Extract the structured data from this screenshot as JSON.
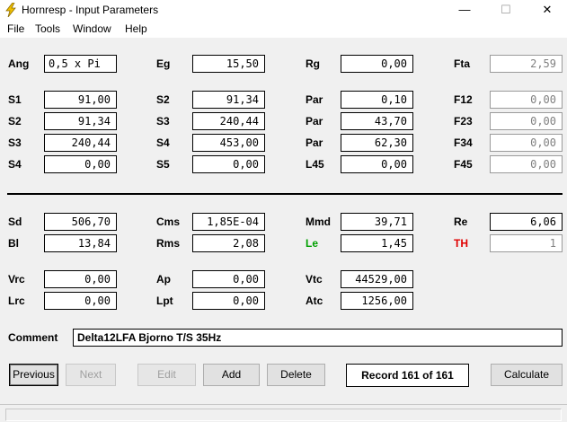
{
  "window": {
    "title": "Hornresp - Input Parameters",
    "min_glyph": "—",
    "max_glyph": "☐",
    "close_glyph": "✕"
  },
  "menu": {
    "file": "File",
    "tools": "Tools",
    "window": "Window",
    "help": "Help"
  },
  "params": {
    "ang": {
      "label": "Ang",
      "value": "0,5 x Pi"
    },
    "eg": {
      "label": "Eg",
      "value": "15,50"
    },
    "rg": {
      "label": "Rg",
      "value": "0,00"
    },
    "fta": {
      "label": "Fta",
      "value": "2,59"
    },
    "s1": {
      "label": "S1",
      "value": "91,00"
    },
    "s2a": {
      "label": "S2",
      "value": "91,34"
    },
    "par1": {
      "label": "Par",
      "value": "0,10"
    },
    "f12": {
      "label": "F12",
      "value": "0,00"
    },
    "s2b": {
      "label": "S2",
      "value": "91,34"
    },
    "s3a": {
      "label": "S3",
      "value": "240,44"
    },
    "par2": {
      "label": "Par",
      "value": "43,70"
    },
    "f23": {
      "label": "F23",
      "value": "0,00"
    },
    "s3b": {
      "label": "S3",
      "value": "240,44"
    },
    "s4a": {
      "label": "S4",
      "value": "453,00"
    },
    "par3": {
      "label": "Par",
      "value": "62,30"
    },
    "f34": {
      "label": "F34",
      "value": "0,00"
    },
    "s4b": {
      "label": "S4",
      "value": "0,00"
    },
    "s5": {
      "label": "S5",
      "value": "0,00"
    },
    "l45": {
      "label": "L45",
      "value": "0,00"
    },
    "f45": {
      "label": "F45",
      "value": "0,00"
    },
    "sd": {
      "label": "Sd",
      "value": "506,70"
    },
    "cms": {
      "label": "Cms",
      "value": "1,85E-04"
    },
    "mmd": {
      "label": "Mmd",
      "value": "39,71"
    },
    "re": {
      "label": "Re",
      "value": "6,06"
    },
    "bl": {
      "label": "Bl",
      "value": "13,84"
    },
    "rms": {
      "label": "Rms",
      "value": "2,08"
    },
    "le": {
      "label": "Le",
      "value": "1,45"
    },
    "th": {
      "label": "TH",
      "value": "1"
    },
    "vrc": {
      "label": "Vrc",
      "value": "0,00"
    },
    "ap": {
      "label": "Ap",
      "value": "0,00"
    },
    "vtc": {
      "label": "Vtc",
      "value": "44529,00"
    },
    "lrc": {
      "label": "Lrc",
      "value": "0,00"
    },
    "lpt": {
      "label": "Lpt",
      "value": "0,00"
    },
    "atc": {
      "label": "Atc",
      "value": "1256,00"
    }
  },
  "comment": {
    "label": "Comment",
    "value": "Delta12LFA Bjorno T/S 35Hz"
  },
  "buttons": {
    "previous": "Previous",
    "next": "Next",
    "edit": "Edit",
    "add": "Add",
    "delete": "Delete",
    "calculate": "Calculate"
  },
  "record": "Record 161 of 161",
  "colors": {
    "le_label": "#00a000",
    "th_label": "#e00000",
    "app_icon": "#f0c000"
  }
}
